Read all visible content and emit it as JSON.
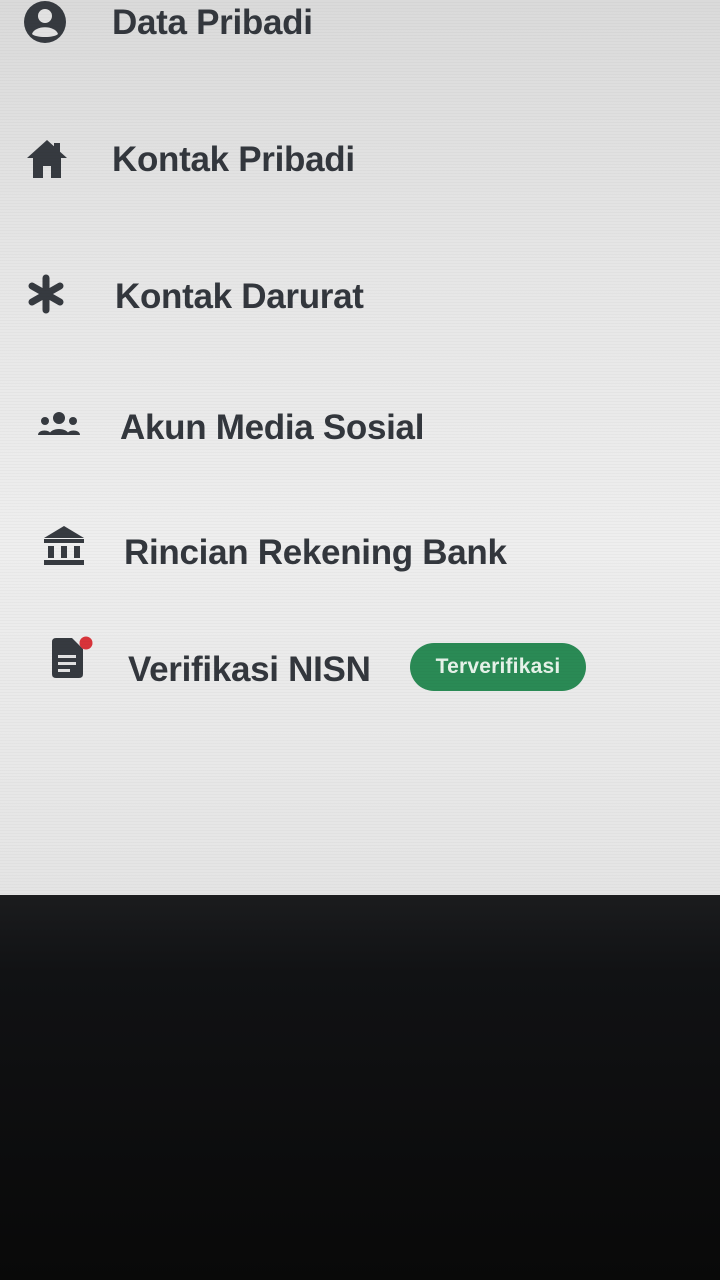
{
  "menu": {
    "items": [
      {
        "label": "Data Pribadi",
        "icon": "person-circle-icon"
      },
      {
        "label": "Kontak Pribadi",
        "icon": "home-icon"
      },
      {
        "label": "Kontak Darurat",
        "icon": "asterisk-icon"
      },
      {
        "label": "Akun Media Sosial",
        "icon": "group-icon"
      },
      {
        "label": "Rincian Rekening Bank",
        "icon": "bank-icon"
      },
      {
        "label": "Verifikasi NISN",
        "icon": "document-icon",
        "badge": "Terverifikasi",
        "notification_dot": true
      }
    ]
  },
  "colors": {
    "text": "#33373d",
    "badge_bg": "#2a8a55",
    "badge_text": "#e6f3ea",
    "notification_dot": "#d8343a",
    "background": "#e6e6e6"
  }
}
